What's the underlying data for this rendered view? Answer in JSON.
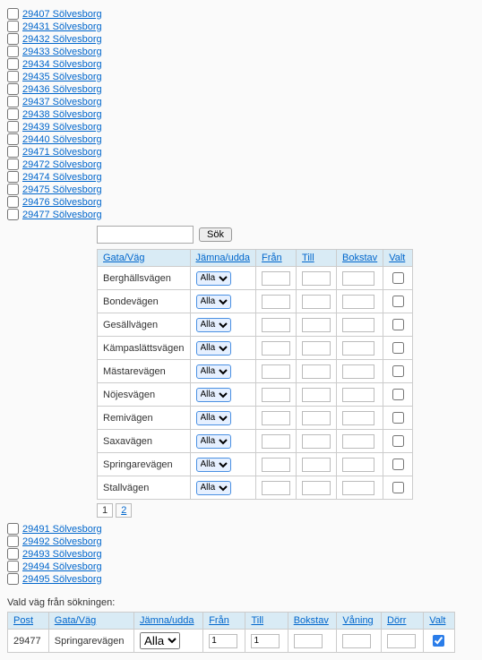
{
  "postal_codes_top": [
    "29407 Sölvesborg",
    "29431 Sölvesborg",
    "29432 Sölvesborg",
    "29433 Sölvesborg",
    "29434 Sölvesborg",
    "29435 Sölvesborg",
    "29436 Sölvesborg",
    "29437 Sölvesborg",
    "29438 Sölvesborg",
    "29439 Sölvesborg",
    "29440 Sölvesborg",
    "29471 Sölvesborg",
    "29472 Sölvesborg",
    "29474 Sölvesborg",
    "29475 Sölvesborg",
    "29476 Sölvesborg",
    "29477 Sölvesborg"
  ],
  "search": {
    "button_label": "Sök",
    "value": ""
  },
  "grid": {
    "headers": {
      "street": "Gata/Väg",
      "evenodd": "Jämna/udda",
      "from": "Från",
      "to": "Till",
      "letter": "Bokstav",
      "selected": "Valt"
    },
    "evenodd_option": "Alla",
    "rows": [
      {
        "street": "Berghällsvägen"
      },
      {
        "street": "Bondevägen"
      },
      {
        "street": "Gesällvägen"
      },
      {
        "street": "Kämpaslättsvägen"
      },
      {
        "street": "Mästarevägen"
      },
      {
        "street": "Nöjesvägen"
      },
      {
        "street": "Remivägen"
      },
      {
        "street": "Saxavägen"
      },
      {
        "street": "Springarevägen"
      },
      {
        "street": "Stallvägen"
      }
    ],
    "pager": {
      "current": "1",
      "other": "2"
    }
  },
  "postal_codes_bottom": [
    "29491 Sölvesborg",
    "29492 Sölvesborg",
    "29493 Sölvesborg",
    "29494 Sölvesborg",
    "29495 Sölvesborg"
  ],
  "selected_section": {
    "label": "Vald väg från sökningen:",
    "headers": {
      "post": "Post",
      "street": "Gata/Väg",
      "evenodd": "Jämna/udda",
      "from": "Från",
      "to": "Till",
      "letter": "Bokstav",
      "floor": "Våning",
      "door": "Dörr",
      "selected": "Valt"
    },
    "row": {
      "post": "29477",
      "street": "Springarevägen",
      "evenodd": "Alla",
      "from": "1",
      "to": "1",
      "letter": "",
      "floor": "",
      "door": "",
      "selected": true
    }
  }
}
